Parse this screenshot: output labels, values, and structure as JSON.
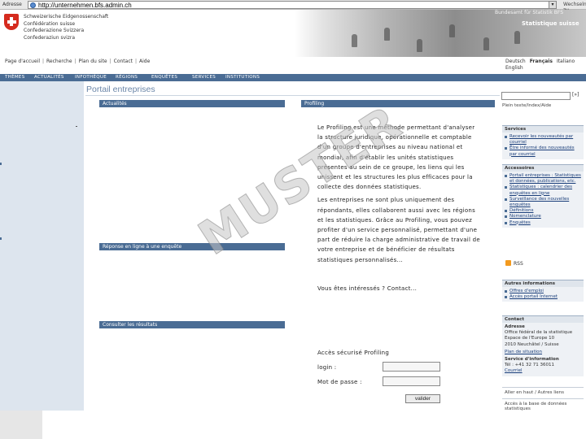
{
  "browser": {
    "address_label": "Adresse",
    "url": "http://unternehmen.bfs.admin.ch",
    "go_label": "Wechseln zu"
  },
  "header": {
    "confederation_lines": [
      "Schweizerische Eidgenossenschaft",
      "Confédération suisse",
      "Confederazione Svizzera",
      "Confederaziun svizra"
    ],
    "office_name": "Bundesamt für Statistik BFS",
    "office_subtitle": "Statistique suisse"
  },
  "utility_nav": [
    "Page d'accueil",
    "Recherche",
    "Plan du site",
    "Contact",
    "Aide"
  ],
  "languages": {
    "label": "Deutsch",
    "items": [
      "Français",
      "Italiano",
      "English"
    ],
    "active": "Français"
  },
  "main_tabs": [
    "THÈMES",
    "ACTUALITÉS",
    "INFOTHÈQUE",
    "RÉGIONS",
    "ENQUÊTES",
    "SERVICES",
    "INSTITUTIONS"
  ],
  "page_title": "Portail entreprises",
  "center_boxes": {
    "actualites": "Actualités",
    "reponse_en_ligne": "Réponse en ligne à une enquête",
    "consulter": "Consulter les résultats"
  },
  "profiling": {
    "header": "Profiling",
    "paragraphs": [
      "Le Profiling est une méthode permettant d'analyser la structure juridique, opérationnelle et comptable d'un groupe d'entreprises au niveau national et mondial, afin d'établir les unités statistiques présentes au sein de ce groupe, les liens qui les unissent et les structures les plus efficaces pour la collecte des données statistiques.",
      "Les entreprises ne sont plus uniquement des répondants, elles collaborent aussi avec les régions et les statistiques. Grâce au Profiling, vous pouvez profiter d'un service personnalisé, permettant d'une part de réduire la charge administrative de travail de votre entreprise et de bénéficier de résultats statistiques personnalisés..."
    ],
    "interest_line": "Vous êtes intéressés ? Contact..."
  },
  "login": {
    "title": "Accès sécurisé Profiling",
    "login_label": "login :",
    "password_label": "Mot de passe :",
    "submit_label": "valider"
  },
  "watermark": "MUSTER",
  "right_column": {
    "search_button": "[»]",
    "search_label": "Plein texte/Index/Aide",
    "services": {
      "title": "Services",
      "items": [
        "Recevoir les nouveautés par courriel",
        "Être informé des nouveautés par courriel"
      ]
    },
    "accessoires": {
      "title": "Accessoires",
      "items": [
        "Portail entreprises : Statistiques et données, publications, etc.",
        "Statistiques : calendrier des enquêtes en ligne",
        "Surveillance des nouvelles enquêtes",
        "Définitions",
        "Nomenclature",
        "Enquêtes"
      ]
    },
    "rss_label": "RSS",
    "autres": {
      "title": "Autres informations",
      "items": [
        "Offres d'emploi",
        "Accès portail Internet"
      ]
    },
    "contact": {
      "title": "Contact",
      "address_heading": "Adresse",
      "address_lines": [
        "Office fédéral de la statistique",
        "Espace de l'Europe 10",
        "2010 Neuchâtel / Suisse"
      ],
      "map_link": "Plan de situation",
      "info_heading": "Service d'information",
      "info_lines": [
        "Tél : +41 32 71 36011",
        "Courriel"
      ]
    },
    "footer_lines": [
      "Aller en haut / Autres liens",
      "Accès à la base de données statistiques"
    ]
  },
  "colors": {
    "nav_blue": "#4a6c94",
    "left_panel": "#dde5ee",
    "title_blue": "#6a86a8",
    "swiss_red": "#d52b1e"
  }
}
